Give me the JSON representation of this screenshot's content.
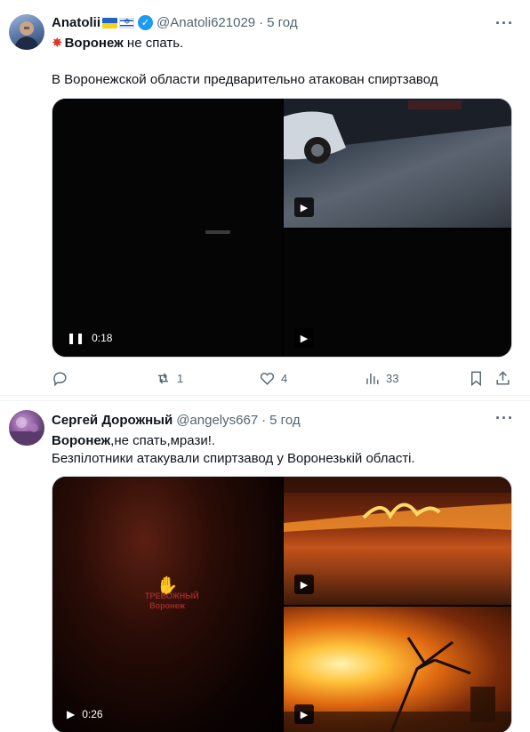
{
  "tweets": [
    {
      "author": {
        "name": "Anatolii",
        "handle": "@Anatoli621029",
        "time": "5 год"
      },
      "text_bold": "Воронеж",
      "text_line1_rest": " не спать.",
      "text_line2": "В Воронежской области предварительно атакован  спиртзавод",
      "media": {
        "video_duration": "0:18"
      },
      "actions": {
        "replies": "",
        "reposts": "1",
        "likes": "4",
        "views": "33"
      }
    },
    {
      "author": {
        "name": "Сергей Дорожный",
        "handle": "@angelys667",
        "time": "5 год"
      },
      "text_bold": "Воронеж",
      "text_line1_rest": ",не спать,мрази!.",
      "text_line2": "Безпілотники атакували спиртзавод у Воронезькій області.",
      "media": {
        "video_duration": "0:26",
        "watermark_line1": "ТРЕВОЖНЫЙ",
        "watermark_line2": "Воронеж"
      }
    }
  ],
  "icons": {
    "more": "more-dots-icon",
    "verified": "verified-badge-icon",
    "reply": "reply-icon",
    "repost": "repost-icon",
    "like": "heart-icon",
    "views": "views-icon",
    "bookmark": "bookmark-icon",
    "share": "share-icon",
    "play": "play-icon",
    "pause": "pause-icon"
  },
  "colors": {
    "muted": "#536471",
    "verified": "#1d9bf0",
    "border": "#cfd9de"
  }
}
